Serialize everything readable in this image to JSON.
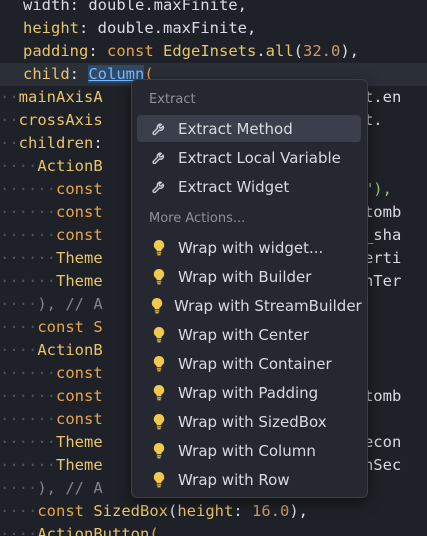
{
  "editor": {
    "lines": [
      {
        "tokens": [
          {
            "t": "width: double.maxFinite,",
            "c": "t-pun"
          }
        ]
      },
      {
        "tokens": [
          {
            "t": "height",
            "c": "t-key"
          },
          {
            "t": ": ",
            "c": "t-pun"
          },
          {
            "t": "double",
            "c": "t-pun"
          },
          {
            "t": ".maxFinite,",
            "c": "t-pun"
          }
        ]
      },
      {
        "tokens": [
          {
            "t": "padding",
            "c": "t-key"
          },
          {
            "t": ": ",
            "c": "t-pun"
          },
          {
            "t": "const ",
            "c": "t-kw"
          },
          {
            "t": "EdgeInsets",
            "c": "t-cls"
          },
          {
            "t": ".",
            "c": "t-pun"
          },
          {
            "t": "all",
            "c": "t-cls"
          },
          {
            "t": "(",
            "c": "t-pun"
          },
          {
            "t": "32.0",
            "c": "t-num"
          },
          {
            "t": "),",
            "c": "t-pun"
          }
        ]
      },
      {
        "current": true,
        "tokens": [
          {
            "t": "child",
            "c": "t-key"
          },
          {
            "t": ": ",
            "c": "t-pun"
          },
          {
            "t": "Column",
            "c": "t-col"
          },
          {
            "t": "(",
            "c": "t-kw"
          }
        ]
      },
      {
        "dots": "··",
        "tokens": [
          {
            "t": "mainAxisA",
            "c": "t-key"
          },
          {
            "t": "                         ment.en",
            "c": "t-pun"
          }
        ]
      },
      {
        "dots": "··",
        "tokens": [
          {
            "t": "crossAxis",
            "c": "t-key"
          },
          {
            "t": "                        nment.",
            "c": "t-pun"
          }
        ]
      },
      {
        "dots": "··",
        "tokens": [
          {
            "t": "children",
            "c": "t-key"
          },
          {
            "t": ":",
            "c": "t-pun"
          }
        ]
      },
      {
        "dots": "····",
        "tokens": [
          {
            "t": "ActionB",
            "c": "t-cls"
          }
        ]
      },
      {
        "dots": "······",
        "tokens": [
          {
            "t": "const",
            "c": "t-kw"
          },
          {
            "t": "                          uk\"),",
            "c": "t-str"
          }
        ]
      },
      {
        "dots": "······",
        "tokens": [
          {
            "t": "const",
            "c": "t-kw"
          },
          {
            "t": "                          n tomb",
            "c": "t-pun"
          }
        ]
      },
      {
        "dots": "······",
        "tokens": [
          {
            "t": "const",
            "c": "t-kw"
          },
          {
            "t": "                          ye_sha",
            "c": "t-pun"
          }
        ]
      },
      {
        "dots": "······",
        "tokens": [
          {
            "t": "Theme",
            "c": "t-cls"
          },
          {
            "t": "                          .terti",
            "c": "t-pun"
          }
        ]
      },
      {
        "dots": "······",
        "tokens": [
          {
            "t": "Theme",
            "c": "t-cls"
          },
          {
            "t": "                          .onTer",
            "c": "t-pun"
          }
        ]
      },
      {
        "dots": "····",
        "tokens": [
          {
            "t": "), // A",
            "c": "t-dim"
          }
        ]
      },
      {
        "dots": "····",
        "tokens": [
          {
            "t": "const S",
            "c": "t-kw"
          }
        ]
      },
      {
        "dots": "····",
        "tokens": [
          {
            "t": "ActionB",
            "c": "t-cls"
          }
        ]
      },
      {
        "dots": "······",
        "tokens": [
          {
            "t": "const",
            "c": "t-kw"
          }
        ]
      },
      {
        "dots": "······",
        "tokens": [
          {
            "t": "const",
            "c": "t-kw"
          },
          {
            "t": "                          n tomb",
            "c": "t-pun"
          }
        ]
      },
      {
        "dots": "······",
        "tokens": [
          {
            "t": "const",
            "c": "t-kw"
          },
          {
            "t": "                          ),",
            "c": "t-pun"
          }
        ]
      },
      {
        "dots": "······",
        "tokens": [
          {
            "t": "Theme",
            "c": "t-cls"
          },
          {
            "t": "                          .secon",
            "c": "t-pun"
          }
        ]
      },
      {
        "dots": "······",
        "tokens": [
          {
            "t": "Theme",
            "c": "t-cls"
          },
          {
            "t": "                          .onSec",
            "c": "t-pun"
          }
        ]
      },
      {
        "dots": "····",
        "tokens": [
          {
            "t": "), // A",
            "c": "t-dim"
          }
        ]
      },
      {
        "dots": "····",
        "tokens": [
          {
            "t": "const ",
            "c": "t-kw"
          },
          {
            "t": "SizedBox",
            "c": "t-cls"
          },
          {
            "t": "(",
            "c": "t-pun"
          },
          {
            "t": "height",
            "c": "t-key"
          },
          {
            "t": ": ",
            "c": "t-pun"
          },
          {
            "t": "16.0",
            "c": "t-num"
          },
          {
            "t": "),",
            "c": "t-pun"
          }
        ]
      },
      {
        "dots": "····",
        "tokens": [
          {
            "t": "ActionButton",
            "c": "t-cls"
          },
          {
            "t": "(",
            "c": "t-kw"
          }
        ]
      }
    ]
  },
  "menu": {
    "extract_title": "Extract",
    "more_title": "More Actions...",
    "extract_items": [
      {
        "label": "Extract Method",
        "icon": "wrench-icon",
        "selected": true
      },
      {
        "label": "Extract Local Variable",
        "icon": "wrench-icon",
        "selected": false
      },
      {
        "label": "Extract Widget",
        "icon": "wrench-icon",
        "selected": false
      }
    ],
    "more_items": [
      {
        "label": "Wrap with widget...",
        "icon": "lightbulb-icon"
      },
      {
        "label": "Wrap with Builder",
        "icon": "lightbulb-icon"
      },
      {
        "label": "Wrap with StreamBuilder",
        "icon": "lightbulb-icon"
      },
      {
        "label": "Wrap with Center",
        "icon": "lightbulb-icon"
      },
      {
        "label": "Wrap with Container",
        "icon": "lightbulb-icon"
      },
      {
        "label": "Wrap with Padding",
        "icon": "lightbulb-icon"
      },
      {
        "label": "Wrap with SizedBox",
        "icon": "lightbulb-icon"
      },
      {
        "label": "Wrap with Column",
        "icon": "lightbulb-icon"
      },
      {
        "label": "Wrap with Row",
        "icon": "lightbulb-icon"
      }
    ]
  },
  "colors": {
    "bulb": "#f2c94c",
    "wrench": "#c9ccd2"
  }
}
